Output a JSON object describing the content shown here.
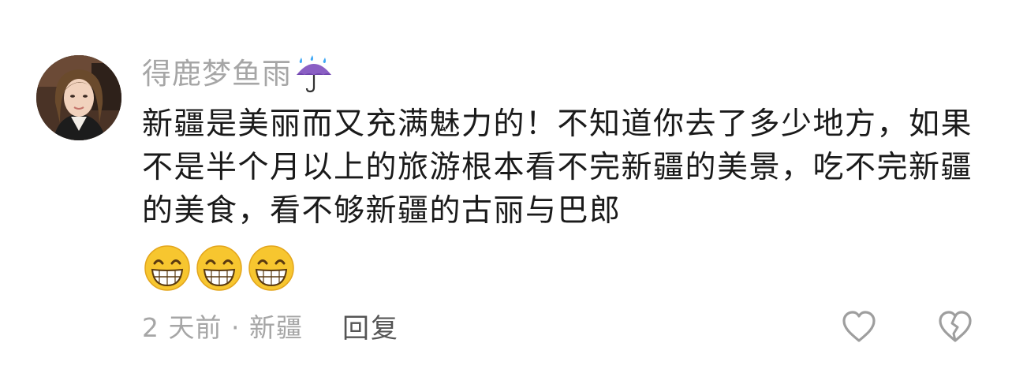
{
  "comment": {
    "username": "得鹿梦鱼雨",
    "username_emoji": "umbrella-with-rain-icon",
    "text": "新疆是美丽而又充满魅力的！不知道你去了多少地方，如果不是半个月以上的旅游根本看不完新疆的美景，吃不完新疆的美食，看不够新疆的古丽与巴郎",
    "trailing_emojis": [
      "grinning-face-icon",
      "grinning-face-icon",
      "grinning-face-icon"
    ],
    "time_location": "2 天前 · 新疆",
    "reply_label": "回复",
    "like_icon": "heart-outline-icon",
    "dislike_icon": "broken-heart-outline-icon"
  },
  "colors": {
    "secondary_text": "#a6a6a6",
    "primary_text": "#1a1a1a",
    "reply_text": "#555555",
    "emoji_yellow": "#f7c62f"
  }
}
